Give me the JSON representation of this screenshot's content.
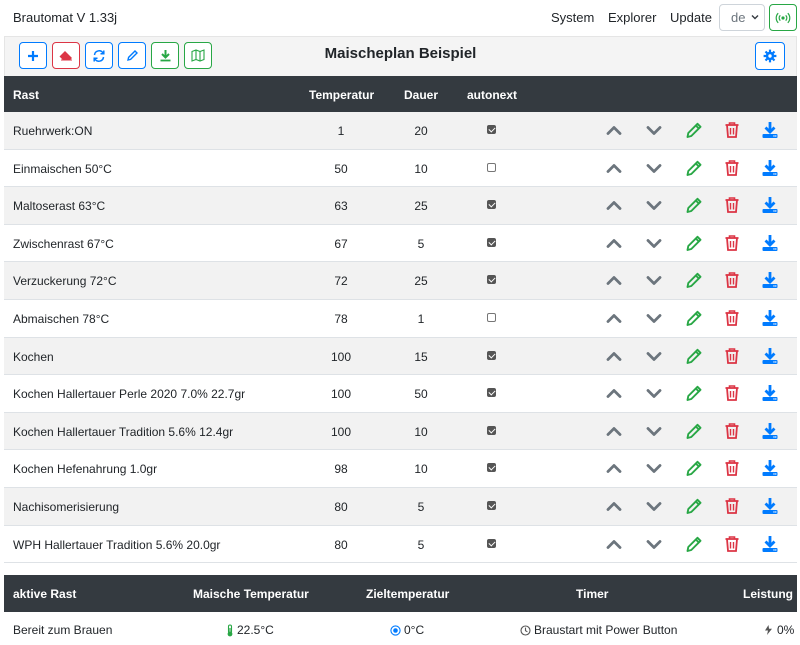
{
  "navbar": {
    "brand": "Brautomat V 1.33j",
    "links": [
      "System",
      "Explorer",
      "Update"
    ],
    "language": "de"
  },
  "toolbar": {
    "title": "Maischeplan Beispiel",
    "buttons": [
      "plus-icon",
      "eraser-icon",
      "refresh-icon",
      "pencil-icon",
      "download-icon",
      "map-icon"
    ],
    "settings_icon": "gear-icon"
  },
  "colors": {
    "header_bg": "#343a40",
    "primary": "#007bff",
    "danger": "#dc3545",
    "success": "#28a745",
    "arrow": "#6c757d"
  },
  "table": {
    "headers": {
      "rast": "Rast",
      "temperatur": "Temperatur",
      "dauer": "Dauer",
      "autonext": "autonext"
    },
    "row_actions": [
      "chevron-up-icon",
      "chevron-down-icon",
      "pencil-icon",
      "trash-icon",
      "download-icon"
    ],
    "rows": [
      {
        "name": "Ruehrwerk:ON",
        "temp": "1",
        "dauer": "20",
        "autonext": true
      },
      {
        "name": "Einmaischen 50°C",
        "temp": "50",
        "dauer": "10",
        "autonext": false
      },
      {
        "name": "Maltoserast 63°C",
        "temp": "63",
        "dauer": "25",
        "autonext": true
      },
      {
        "name": "Zwischenrast 67°C",
        "temp": "67",
        "dauer": "5",
        "autonext": true
      },
      {
        "name": "Verzuckerung 72°C",
        "temp": "72",
        "dauer": "25",
        "autonext": true
      },
      {
        "name": "Abmaischen 78°C",
        "temp": "78",
        "dauer": "1",
        "autonext": false
      },
      {
        "name": "Kochen",
        "temp": "100",
        "dauer": "15",
        "autonext": true
      },
      {
        "name": "Kochen Hallertauer Perle 2020 7.0% 22.7gr",
        "temp": "100",
        "dauer": "50",
        "autonext": true
      },
      {
        "name": "Kochen Hallertauer Tradition 5.6% 12.4gr",
        "temp": "100",
        "dauer": "10",
        "autonext": true
      },
      {
        "name": "Kochen Hefenahrung 1.0gr",
        "temp": "98",
        "dauer": "10",
        "autonext": true
      },
      {
        "name": "Nachisomerisierung",
        "temp": "80",
        "dauer": "5",
        "autonext": true
      },
      {
        "name": "WPH Hallertauer Tradition 5.6% 20.0gr",
        "temp": "80",
        "dauer": "5",
        "autonext": true
      }
    ]
  },
  "status": {
    "headers": {
      "rast": "aktive Rast",
      "maische": "Maische Temperatur",
      "ziel": "Zieltemperatur",
      "timer": "Timer",
      "leistung": "Leistung"
    },
    "values": {
      "rast": "Bereit zum Brauen",
      "maische": "22.5°C",
      "ziel": "0°C",
      "timer": "Braustart mit Power Button",
      "leistung": "0%"
    },
    "icons": [
      "thermometer-icon",
      "target-icon",
      "clock-icon",
      "power-icon"
    ]
  }
}
